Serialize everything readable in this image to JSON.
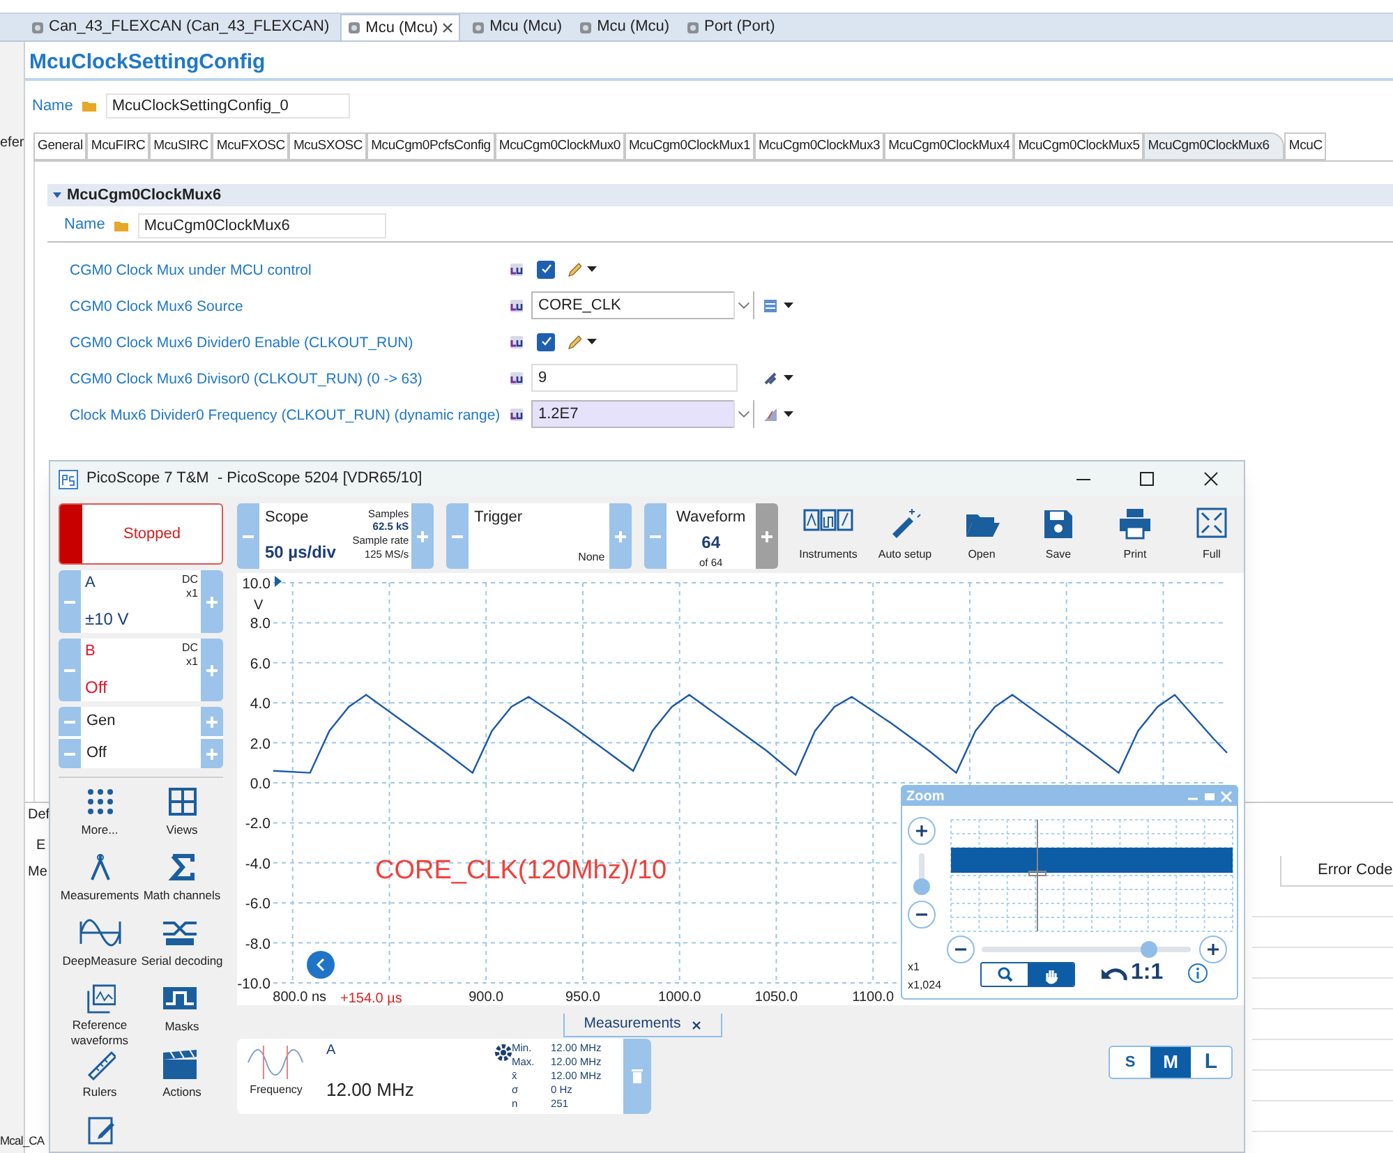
{
  "editor_tabs": [
    {
      "label": "Can_43_FLEXCAN (Can_43_FLEXCAN)",
      "selected": false
    },
    {
      "label": "Mcu (Mcu)",
      "selected": true
    },
    {
      "label": "Mcu (Mcu)",
      "selected": false
    },
    {
      "label": "Mcu (Mcu)",
      "selected": false
    },
    {
      "label": "Port (Port)",
      "selected": false
    }
  ],
  "left_fragments": [
    "efer",
    "Def",
    "E",
    "Me",
    "Mcal_CA"
  ],
  "page_title": "McuClockSettingConfig",
  "name_field": {
    "label": "Name",
    "value": "McuClockSettingConfig_0"
  },
  "config_tabs": [
    {
      "label": "General",
      "selected": false
    },
    {
      "label": "McuFIRC",
      "selected": false
    },
    {
      "label": "McuSIRC",
      "selected": false
    },
    {
      "label": "McuFXOSC",
      "selected": false
    },
    {
      "label": "McuSXOSC",
      "selected": false
    },
    {
      "label": "McuCgm0PcfsConfig",
      "selected": false
    },
    {
      "label": "McuCgm0ClockMux0",
      "selected": false
    },
    {
      "label": "McuCgm0ClockMux1",
      "selected": false
    },
    {
      "label": "McuCgm0ClockMux3",
      "selected": false
    },
    {
      "label": "McuCgm0ClockMux4",
      "selected": false
    },
    {
      "label": "McuCgm0ClockMux5",
      "selected": false
    },
    {
      "label": "McuCgm0ClockMux6",
      "selected": true
    },
    {
      "label": "McuC",
      "selected": false
    }
  ],
  "section": {
    "title": "McuCgm0ClockMux6",
    "expanded": true,
    "name_field": {
      "label": "Name",
      "value": "McuCgm0ClockMux6"
    },
    "rows": [
      {
        "kind": "checkbox",
        "label": "CGM0 Clock Mux under MCU control",
        "checked": true
      },
      {
        "kind": "select",
        "label": "CGM0 Clock Mux6 Source",
        "value": "CORE_CLK",
        "computed": false
      },
      {
        "kind": "checkbox",
        "label": "CGM0 Clock Mux6 Divider0 Enable (CLKOUT_RUN)",
        "checked": true
      },
      {
        "kind": "number",
        "label": "CGM0 Clock Mux6 Divisor0 (CLKOUT_RUN) (0 -> 63)",
        "value": "9"
      },
      {
        "kind": "select",
        "label": "Clock Mux6 Divider0 Frequency (CLKOUT_RUN) (dynamic range)",
        "value": "1.2E7",
        "computed": true
      }
    ]
  },
  "lower_panel": {
    "column_header": "Error Code"
  },
  "picoscope": {
    "title": "PicoScope 7 T&M  - PicoScope 5204 [VDR65/10]",
    "run_button": {
      "label": "Stopped",
      "running": false
    },
    "scope": {
      "label": "Scope",
      "value": "50 µs/div",
      "samples_label": "Samples",
      "samples": "62.5 kS",
      "rate_label": "Sample rate",
      "rate": "125 MS/s"
    },
    "trigger": {
      "label": "Trigger",
      "mode": "None"
    },
    "waveform": {
      "label": "Waveform",
      "value": "64",
      "total": "of 64"
    },
    "tools": [
      {
        "kind": "instruments",
        "label": "Instruments"
      },
      {
        "kind": "autosetup",
        "label": "Auto setup"
      },
      {
        "kind": "open",
        "label": "Open"
      },
      {
        "kind": "save",
        "label": "Save"
      },
      {
        "kind": "print",
        "label": "Print"
      },
      {
        "kind": "full",
        "label": "Full"
      }
    ],
    "channels": [
      {
        "name": "A",
        "coupling": "DC",
        "probe": "x1",
        "range": "±10 V",
        "color": "#1b3f73"
      },
      {
        "name": "B",
        "coupling": "DC",
        "probe": "x1",
        "range": "Off",
        "color": "#e2162b"
      }
    ],
    "generator": {
      "label": "Gen",
      "state": "Off"
    },
    "side_tools": [
      {
        "kind": "more",
        "label": "More..."
      },
      {
        "kind": "views",
        "label": "Views"
      },
      {
        "kind": "measurements",
        "label": "Measurements"
      },
      {
        "kind": "math",
        "label": "Math channels"
      },
      {
        "kind": "deep",
        "label": "DeepMeasure"
      },
      {
        "kind": "serial",
        "label": "Serial decoding"
      },
      {
        "kind": "reference",
        "label": "Reference waveforms"
      },
      {
        "kind": "masks",
        "label": "Masks"
      },
      {
        "kind": "rulers",
        "label": "Rulers"
      },
      {
        "kind": "actions",
        "label": "Actions"
      },
      {
        "kind": "notes"
      }
    ],
    "graph": {
      "offset_label": "+154.0 µs",
      "annotation": "CORE_CLK(120Mhz)/10",
      "chart_data": {
        "type": "line",
        "ylabel": "V",
        "x": [
          790,
          809,
          819,
          829,
          838,
          858,
          878,
          893,
          903,
          913,
          922,
          942,
          962,
          976,
          986,
          996,
          1005,
          1025,
          1045,
          1060,
          1070,
          1080,
          1089,
          1109,
          1129,
          1143,
          1153,
          1163,
          1172,
          1192,
          1212,
          1227,
          1237,
          1247,
          1256,
          1276,
          1283
        ],
        "series": [
          {
            "color": "#1c5aa6",
            "values": [
              0.6,
              0.5,
              2.6,
              3.8,
              4.4,
              3.0,
              1.6,
              0.5,
              2.6,
              3.8,
              4.3,
              3.0,
              1.6,
              0.6,
              2.6,
              3.8,
              4.4,
              3.0,
              1.6,
              0.4,
              2.6,
              3.8,
              4.3,
              3.0,
              1.6,
              0.5,
              2.6,
              3.8,
              4.4,
              3.0,
              1.6,
              0.5,
              2.6,
              3.8,
              4.4,
              2.2,
              1.5
            ]
          }
        ],
        "xlim": [
          790,
          1283
        ],
        "ylim": [
          -10,
          10
        ],
        "grid": true,
        "xticks": [
          {
            "value": 800,
            "label": "800.0 ns"
          },
          {
            "value": 900,
            "label": "900.0"
          },
          {
            "value": 950,
            "label": "950.0"
          },
          {
            "value": 1000,
            "label": "1000.0"
          },
          {
            "value": 1050,
            "label": "1050.0"
          },
          {
            "value": 1100,
            "label": "1100.0"
          }
        ],
        "yticks": [
          {
            "value": 10,
            "label": "10.0"
          },
          {
            "value": 8,
            "label": "8.0"
          },
          {
            "value": 6,
            "label": "6.0"
          },
          {
            "value": 4,
            "label": "4.0"
          },
          {
            "value": 2,
            "label": "2.0"
          },
          {
            "value": 0,
            "label": "0.0"
          },
          {
            "value": -2,
            "label": "-2.0"
          },
          {
            "value": -4,
            "label": "-4.0"
          },
          {
            "value": -6,
            "label": "-6.0"
          },
          {
            "value": -8,
            "label": "-8.0"
          },
          {
            "value": -10,
            "label": "-10.0"
          }
        ]
      }
    },
    "zoom_panel": {
      "title": "Zoom",
      "vertical": {
        "level": 0.15
      },
      "horizontal": {
        "level": 0.8
      },
      "scale_x": "x1",
      "scale_y": "x1,024",
      "modes": [
        {
          "kind": "zoom",
          "selected": false
        },
        {
          "kind": "pan",
          "selected": true
        }
      ],
      "reset_label": "1:1"
    },
    "measurements_tab": {
      "label": "Measurements"
    },
    "measurement": {
      "channel": "A",
      "name": "Frequency",
      "value": "12.00 MHz",
      "stats": [
        {
          "label": "Min.",
          "value": "12.00 MHz"
        },
        {
          "label": "Max.",
          "value": "12.00 MHz"
        },
        {
          "label": "x̄",
          "value": "12.00 MHz"
        },
        {
          "label": "σ",
          "value": "0 Hz"
        },
        {
          "label": "n",
          "value": "251"
        }
      ]
    },
    "size_toggle": [
      {
        "label": "S",
        "selected": false
      },
      {
        "label": "M",
        "selected": true
      },
      {
        "label": "L",
        "selected": false
      }
    ]
  }
}
